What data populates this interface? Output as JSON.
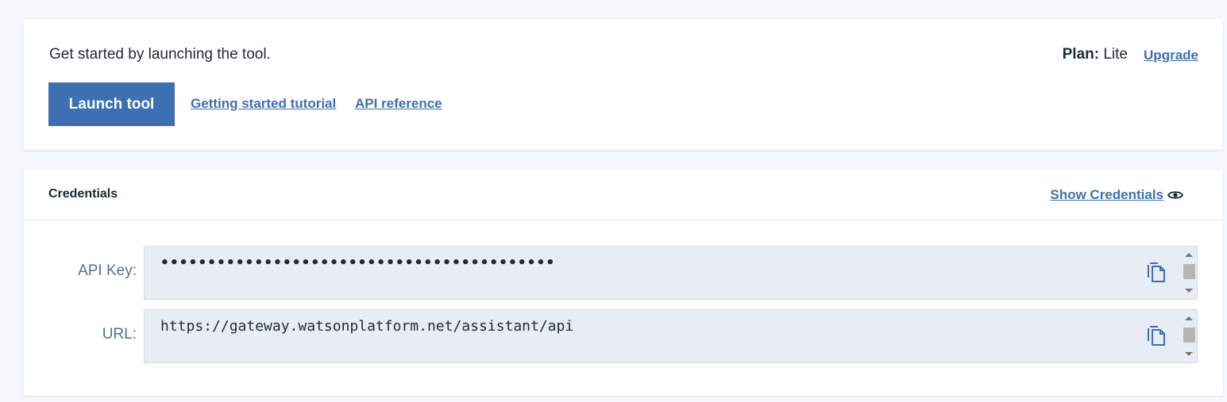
{
  "launch_card": {
    "intro_text": "Get started by launching the tool.",
    "launch_button_label": "Launch tool",
    "links": {
      "tutorial": "Getting started tutorial",
      "api_reference": "API reference",
      "upgrade": "Upgrade"
    },
    "plan": {
      "label": "Plan:",
      "value": "Lite"
    }
  },
  "credentials_card": {
    "title": "Credentials",
    "show_credentials_label": "Show Credentials",
    "show_credentials_icon": "eye-icon",
    "fields": {
      "api_key": {
        "label": "API Key:",
        "value": "••••••••••••••••••••••••••••••••••••••••••"
      },
      "url": {
        "label": "URL:",
        "value": "https://gateway.watsonplatform.net/assistant/api"
      }
    },
    "copy_icon": "copy-icon"
  },
  "colors": {
    "page_background": "#f4f7fb",
    "accent": "#3d70b2",
    "field_background": "#e8edf4",
    "label_color": "#5a6f8c"
  }
}
